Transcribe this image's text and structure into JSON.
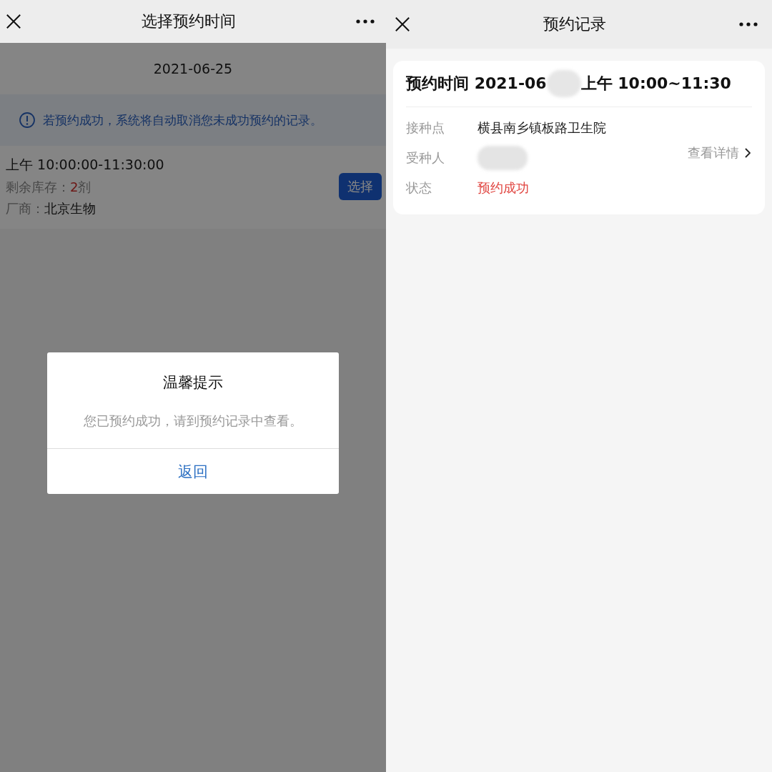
{
  "left_screen": {
    "title": "选择预约时间",
    "date": "2021-06-25",
    "notice": "若预约成功，系统将自动取消您未成功预约的记录。",
    "slot": {
      "time": "上午 10:00:00-11:30:00",
      "stock_label": "剩余库存：",
      "stock_value": "2",
      "stock_unit": "剂",
      "maker_label": "厂商：",
      "maker_value": "北京生物",
      "button": "选择"
    },
    "dialog": {
      "title": "温馨提示",
      "message": "您已预约成功，请到预约记录中查看。",
      "button": "返回"
    }
  },
  "right_screen": {
    "title": "预约记录",
    "record": {
      "title_prefix": "预约时间 2021-06",
      "title_suffix": "上午 10:00~11:30",
      "fields": [
        {
          "label": "接种点",
          "value": "横县南乡镇板路卫生院",
          "kind": "text"
        },
        {
          "label": "受种人",
          "kind": "redacted"
        },
        {
          "label": "状态",
          "value": "预约成功",
          "kind": "status"
        }
      ],
      "detail_link": "查看详情"
    }
  }
}
